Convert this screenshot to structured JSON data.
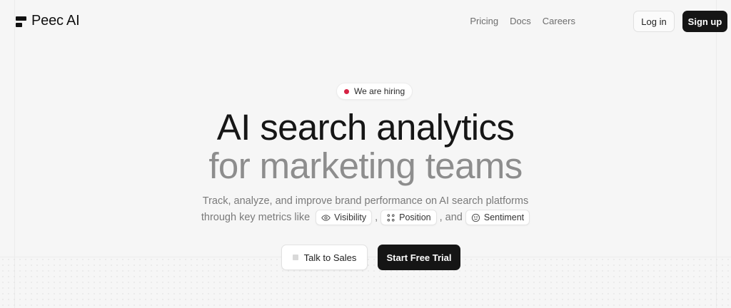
{
  "brand": {
    "name": "Peec AI"
  },
  "nav": {
    "items": [
      "Pricing",
      "Docs",
      "Careers"
    ]
  },
  "auth": {
    "login_label": "Log in",
    "signup_label": "Sign up"
  },
  "hero": {
    "badge": "We are hiring",
    "headline_1": "AI search analytics",
    "headline_2": "for marketing teams",
    "subtitle_1": "Track, analyze, and improve brand performance on AI search platforms",
    "subtitle_2_prefix": "through key metrics like",
    "metrics": [
      "Visibility",
      "Position",
      "Sentiment"
    ],
    "sep_1": ",",
    "sep_2": ", and"
  },
  "cta": {
    "sales_label": "Talk to Sales",
    "trial_label": "Start Free Trial"
  },
  "icons": {
    "visibility": "eye-icon",
    "position": "position-icon",
    "sentiment": "smiley-icon"
  },
  "colors": {
    "primary_button": "#151515",
    "badge_dot": "#d62344",
    "headline_muted": "#8d8d8d"
  }
}
